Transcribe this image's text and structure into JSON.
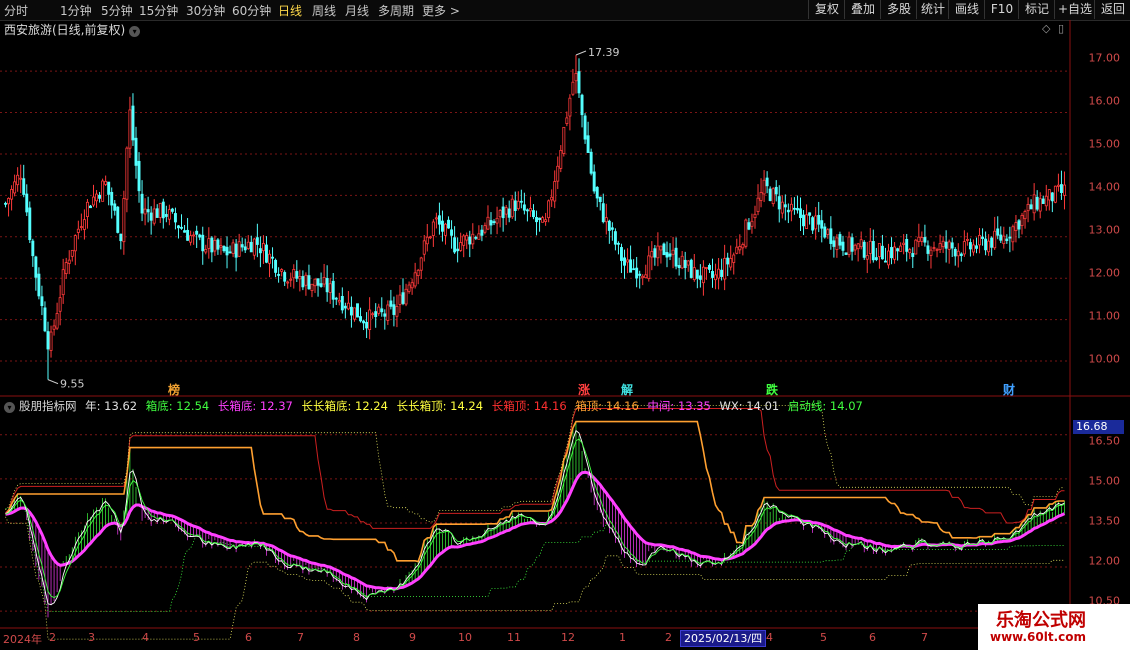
{
  "toolbar": {
    "periods": [
      "分时",
      "1分钟",
      "5分钟",
      "15分钟",
      "30分钟",
      "60分钟",
      "日线",
      "周线",
      "月线",
      "多周期",
      "更多 >"
    ],
    "active_period": "日线",
    "tools": [
      "复权",
      "叠加",
      "多股",
      "统计",
      "画线",
      "F10",
      "标记",
      "+自选",
      "返回"
    ]
  },
  "price_panel": {
    "title": "西安旅游(日线,前复权)",
    "high_label": "17.39",
    "low_label": "9.55",
    "axis": [
      "17.00",
      "16.00",
      "15.00",
      "14.00",
      "13.00",
      "12.00",
      "11.00",
      "10.00"
    ],
    "markers": [
      {
        "text": "榜",
        "color": "#f0a030"
      },
      {
        "text": "涨",
        "color": "#ff4040"
      },
      {
        "text": "解",
        "color": "#40e0e0"
      },
      {
        "text": "跌",
        "color": "#40ff40"
      },
      {
        "text": "财",
        "color": "#40a0ff"
      }
    ]
  },
  "indicator_panel": {
    "name": "股朋指标网",
    "values": [
      {
        "label": "年: 13.62",
        "color": "#e0e0e0"
      },
      {
        "label": "箱底: 12.54",
        "color": "#40ff40"
      },
      {
        "label": "长箱底: 12.37",
        "color": "#ff40ff"
      },
      {
        "label": "长长箱底: 12.24",
        "color": "#ffff40"
      },
      {
        "label": "长长箱顶: 14.24",
        "color": "#ffff40"
      },
      {
        "label": "长箱顶: 14.16",
        "color": "#ff3030"
      },
      {
        "label": "箱顶: 14.16",
        "color": "#ffa030"
      },
      {
        "label": "中间: 13.35",
        "color": "#ff40ff"
      },
      {
        "label": "WX: 14.01",
        "color": "#e0e0e0"
      },
      {
        "label": "启动线: 14.07",
        "color": "#40ff40"
      }
    ],
    "axis": [
      "16.50",
      "15.00",
      "13.50",
      "12.00",
      "10.50"
    ],
    "current": "16.68"
  },
  "x_axis": {
    "labels": [
      "2024年",
      "2",
      "3",
      "4",
      "5",
      "6",
      "7",
      "8",
      "9",
      "10",
      "11",
      "12",
      "1",
      "2",
      "2025/02/13/四",
      "4",
      "5",
      "6",
      "7"
    ]
  },
  "watermark": {
    "title": "乐淘公式网",
    "url": "www.60lt.com"
  },
  "chart_data": {
    "type": "candlestick",
    "title": "西安旅游(日线,前复权)",
    "ylim": [
      9.3,
      17.8
    ],
    "max_marker": 17.39,
    "min_marker": 9.55,
    "months": [
      "2024年",
      "2",
      "3",
      "4",
      "5",
      "6",
      "7",
      "8",
      "9",
      "10",
      "11",
      "12",
      "1",
      "2",
      "3",
      "4",
      "5",
      "6",
      "7"
    ],
    "month_end_close": [
      14.2,
      13.4,
      13.9,
      13.1,
      12.9,
      12.7,
      12.5,
      12.0,
      11.1,
      12.9,
      13.2,
      13.5,
      12.3,
      13.3,
      13.4,
      13.2,
      12.8,
      12.7,
      13.8
    ],
    "indicators": {
      "年": 13.62,
      "箱底": 12.54,
      "长箱底": 12.37,
      "长长箱底": 12.24,
      "长长箱顶": 14.24,
      "长箱顶": 14.16,
      "箱顶": 14.16,
      "中间": 13.35,
      "WX": 14.01,
      "启动线": 14.07
    },
    "indicator_ylim": [
      10.2,
      17.0
    ]
  }
}
